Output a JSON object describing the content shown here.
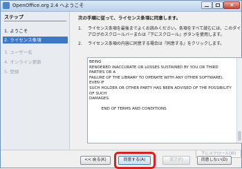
{
  "window": {
    "title": "OpenOffice.org 2.4 へようこそ",
    "close_glyph": "✕"
  },
  "sidebar": {
    "heading": "ステップ",
    "steps": [
      {
        "label": "1. ようこそ",
        "state": "done"
      },
      {
        "label": "2. ライセンス条項",
        "state": "current"
      },
      {
        "label": "3. ユーザー名",
        "state": "future"
      },
      {
        "label": "4. オンライン更新",
        "state": "future"
      },
      {
        "label": "5. 登録",
        "state": "future"
      }
    ]
  },
  "main": {
    "heading": "次の手順に従って、ライセンス条項に同意します。",
    "instructions": [
      {
        "num": "1.",
        "text": "ライセンス条項を最後までよくお読みください。条項をすべて読むには、このダイアログのスクロールバーまたは『下にスクロール』ボタンを使用します。"
      },
      {
        "num": "2.",
        "text": "ライセンス条項の内容に同意する場合は『同意する』をクリックします。"
      }
    ],
    "license_lines": [
      "BEING",
      "RENDERED INACCURATE OR LOSSES SUSTAINED BY YOU OR THIRD",
      "PARTIES OR A",
      "FAILURE OF THE LIBRARY TO OPERATE WITH ANY OTHER SOFTWARE),",
      "EVEN IF",
      "SUCH HOLDER OR OTHER PARTY HAS BEEN ADVISED OF THE POSSIBILITY",
      "OF SUCH",
      "DAMAGES.",
      "",
      "          END OF TERMS AND CONDITIONS"
    ],
    "scroll_down_label": "下にスクロール(W)"
  },
  "buttons": {
    "back": "<< 戻る(K)",
    "accept": "同意する(A)",
    "finish": "完了(F)",
    "decline": "同意しない(D)"
  },
  "colors": {
    "accent": "#3a78c9",
    "highlight": "#e21c1c"
  }
}
